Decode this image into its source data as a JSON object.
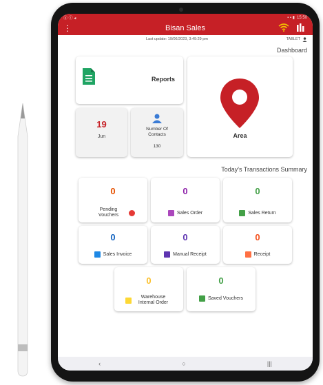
{
  "status_bar": {
    "left": "ⓤ ⓘ ◂",
    "right": "15:50"
  },
  "app_bar": {
    "title": "Bisan Sales"
  },
  "info_bar": {
    "last_update": "Last update: 19/06/2023, 3:49:29 pm",
    "device": "TABLET"
  },
  "dashboard": {
    "section_title": "Dashboard",
    "reports_label": "Reports",
    "area_label": "Area",
    "contacts_label": "Number Of Contacts",
    "contacts_count": "130",
    "date_day": "19",
    "date_month": "Jun"
  },
  "transactions": {
    "section_title": "Today's Transactions Summary",
    "rows": [
      [
        {
          "label": "Sales Return",
          "count": "0",
          "color": "#43a047",
          "icon": "money-icon"
        },
        {
          "label": "Sales Order",
          "count": "0",
          "color": "#8e24aa",
          "icon": "cart-icon"
        },
        {
          "label": "Pending Vouchers",
          "count": "0",
          "color": "#e65100",
          "icon": "pause-icon"
        }
      ],
      [
        {
          "label": "Receipt",
          "count": "0",
          "color": "#f4511e",
          "icon": "receipt-icon"
        },
        {
          "label": "Manual Receipt",
          "count": "0",
          "color": "#5e35b1",
          "icon": "books-icon"
        },
        {
          "label": "Sales Invoice",
          "count": "0",
          "color": "#1565c0",
          "icon": "invoice-icon"
        }
      ],
      [
        {
          "label": "Saved Vouchers",
          "count": "0",
          "color": "#43a047",
          "icon": "save-icon"
        },
        {
          "label": "Warehouse Internal Order",
          "count": "0",
          "color": "#fbc02d",
          "icon": "warehouse-icon"
        }
      ]
    ]
  },
  "nav_bar": {
    "back": "‹",
    "home": "○",
    "recents": "|||"
  },
  "colors": {
    "primary": "#c62026",
    "green": "#43a047",
    "purple": "#8e24aa",
    "blue": "#1565c0",
    "orange": "#f4511e",
    "yellow": "#fbc02d"
  }
}
